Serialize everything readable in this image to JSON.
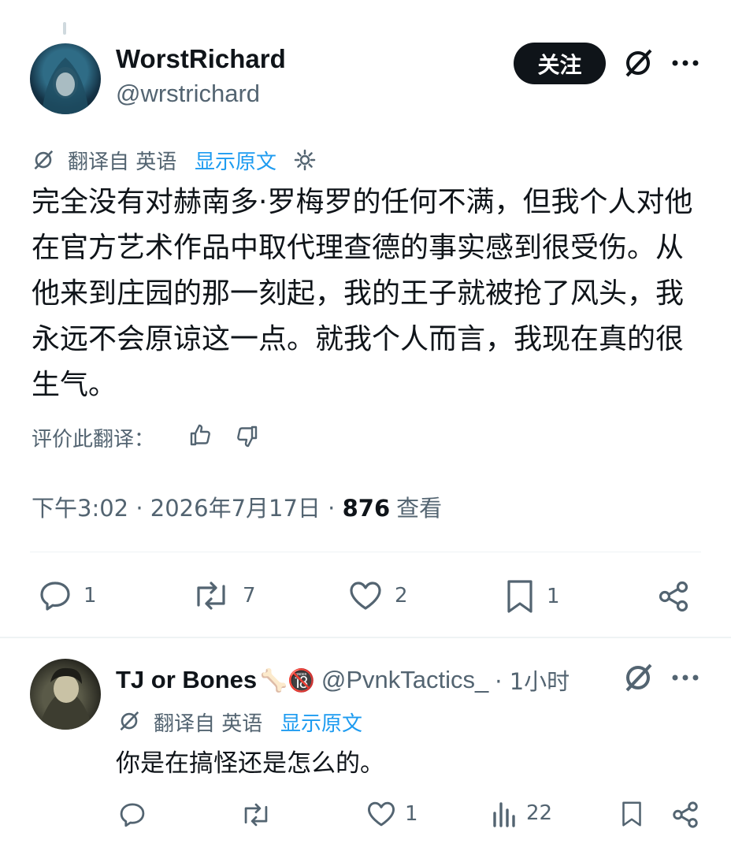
{
  "post": {
    "display_name": "WorstRichard",
    "handle": "@wrstrichard",
    "follow_label": "关注",
    "translated_from": "翻译自 英语",
    "show_original": "显示原文",
    "text": "完全没有对赫南多·罗梅罗的任何不满，但我个人对他在官方艺术作品中取代理查德的事实感到很受伤。从他来到庄园的那一刻起，我的王子就被抢了风头，我永远不会原谅这一点。就我个人而言，我现在真的很生气。",
    "rate_translation": "评价此翻译：",
    "time": "下午3:02",
    "date": "2026年7月17日",
    "views_count": "876",
    "views_label": "查看",
    "stats": {
      "replies": "1",
      "reposts": "7",
      "likes": "2",
      "bookmarks": "1"
    }
  },
  "reply": {
    "display_name": "TJ or Bones",
    "emoji_badges": "🦴🔞",
    "handle": "@PvnkTactics_",
    "time": "· 1小时",
    "translated_from": "翻译自 英语",
    "show_original": "显示原文",
    "text": "你是在搞怪还是怎么的。",
    "stats": {
      "likes": "1",
      "views": "22"
    }
  }
}
